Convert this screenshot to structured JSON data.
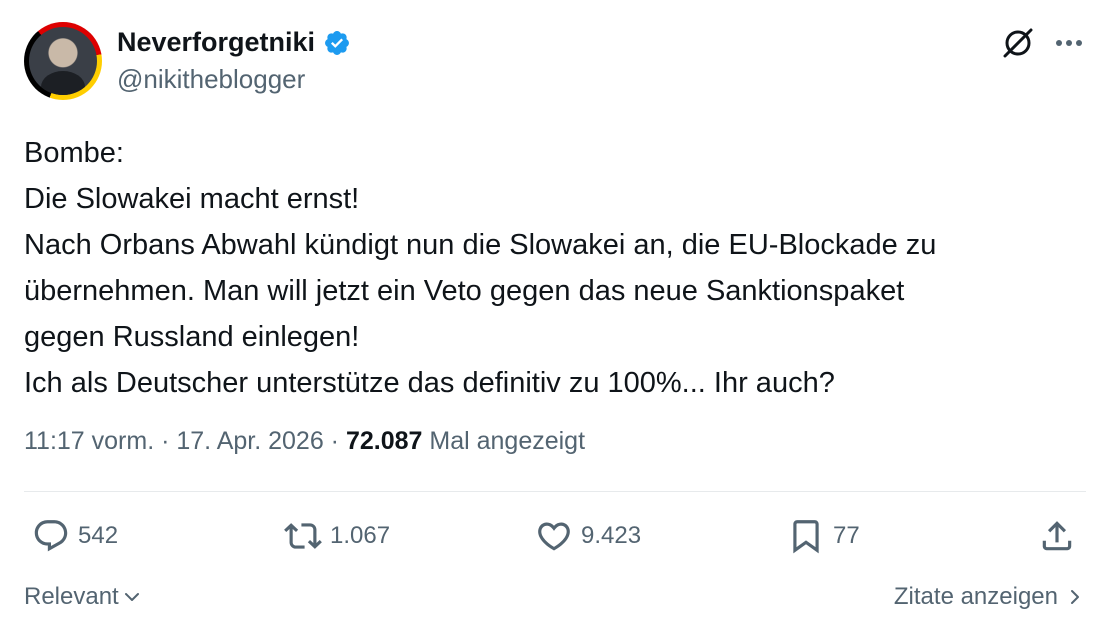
{
  "author": {
    "name": "Neverforgetniki",
    "handle": "@nikitheblogger"
  },
  "tweet": {
    "lines": [
      "Bombe:",
      "Die Slowakei macht ernst!",
      "Nach Orbans Abwahl kündigt nun die Slowakei an, die EU-Blockade zu",
      "übernehmen. Man will jetzt ein Veto gegen das neue Sanktionspaket",
      "gegen Russland einlegen!",
      "Ich als Deutscher unterstütze das definitiv zu 100%... Ihr auch?"
    ]
  },
  "meta": {
    "time": "11:17 vorm.",
    "sep1": " · ",
    "date": "17. Apr. 2026",
    "sep2": " · ",
    "views": "72.087",
    "views_label": "Mal angezeigt"
  },
  "actions": {
    "replies": "542",
    "reposts": "1.067",
    "likes": "9.423",
    "bookmarks": "77"
  },
  "footer": {
    "sort_label": "Relevant",
    "quotes_label": "Zitate anzeigen"
  },
  "colors": {
    "verified": "#1d9bf0",
    "secondary_text": "#536471",
    "primary_text": "#0f1419"
  },
  "icons": [
    "verified-badge-icon",
    "grok-icon",
    "more-icon",
    "reply-icon",
    "repost-icon",
    "like-icon",
    "bookmark-icon",
    "share-icon",
    "chevron-down-icon",
    "chevron-right-icon"
  ]
}
